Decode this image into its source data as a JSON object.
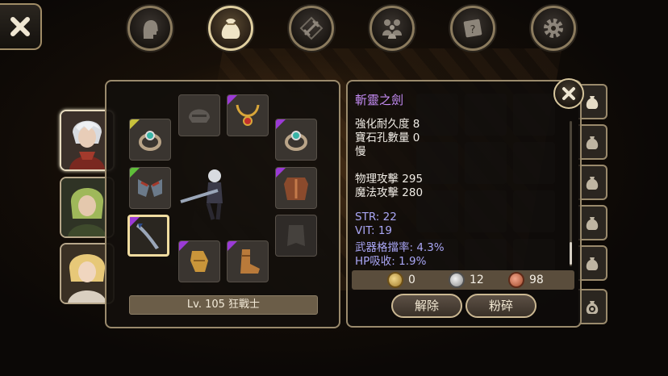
{
  "top_nav": {
    "close_icon": "close-x-icon",
    "tabs": [
      {
        "icon": "character-head-icon",
        "active": false
      },
      {
        "icon": "bag-icon",
        "active": true
      },
      {
        "icon": "sword-skill-icon",
        "active": false
      },
      {
        "icon": "party-icon",
        "active": false
      },
      {
        "icon": "quest-scroll-icon",
        "active": false
      },
      {
        "icon": "settings-gear-icon",
        "active": false
      }
    ]
  },
  "party": [
    {
      "name": "white-haired-hero",
      "active": true
    },
    {
      "name": "green-haired-ally",
      "active": false
    },
    {
      "name": "blonde-ally",
      "active": false
    }
  ],
  "equipment": {
    "level_label": "Lv. 105 狂戰士",
    "rarity_colors": {
      "yellow": "#c8c23c",
      "green": "#5fbf3a",
      "purple": "#9b3ad6"
    }
  },
  "item_detail": {
    "name": "斬靈之劍",
    "lines": [
      "強化耐久度 8",
      "寶石孔數量 0",
      "慢"
    ],
    "attack": [
      "物理攻擊 295",
      "魔法攻擊 280"
    ],
    "bonuses": [
      "STR: 22",
      "VIT: 19",
      "武器格擋率: 4.3%",
      "HP吸收: 1.9%"
    ],
    "currency": {
      "gold": "0",
      "silver": "12",
      "copper": "98"
    },
    "buttons": {
      "unequip": "解除",
      "smash": "粉碎"
    }
  }
}
